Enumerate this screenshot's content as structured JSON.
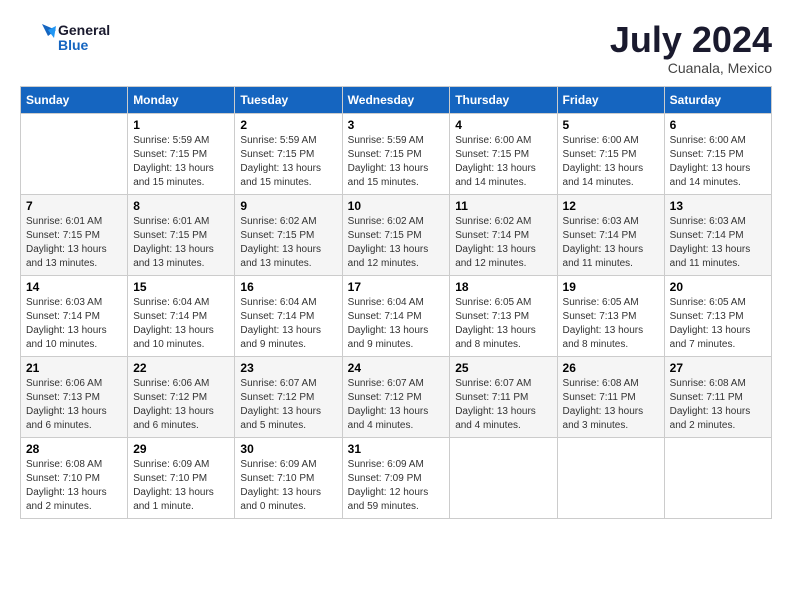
{
  "header": {
    "logo_line1": "General",
    "logo_line2": "Blue",
    "month_year": "July 2024",
    "location": "Cuanala, Mexico"
  },
  "days_of_week": [
    "Sunday",
    "Monday",
    "Tuesday",
    "Wednesday",
    "Thursday",
    "Friday",
    "Saturday"
  ],
  "weeks": [
    [
      {
        "num": "",
        "info": ""
      },
      {
        "num": "1",
        "info": "Sunrise: 5:59 AM\nSunset: 7:15 PM\nDaylight: 13 hours\nand 15 minutes."
      },
      {
        "num": "2",
        "info": "Sunrise: 5:59 AM\nSunset: 7:15 PM\nDaylight: 13 hours\nand 15 minutes."
      },
      {
        "num": "3",
        "info": "Sunrise: 5:59 AM\nSunset: 7:15 PM\nDaylight: 13 hours\nand 15 minutes."
      },
      {
        "num": "4",
        "info": "Sunrise: 6:00 AM\nSunset: 7:15 PM\nDaylight: 13 hours\nand 14 minutes."
      },
      {
        "num": "5",
        "info": "Sunrise: 6:00 AM\nSunset: 7:15 PM\nDaylight: 13 hours\nand 14 minutes."
      },
      {
        "num": "6",
        "info": "Sunrise: 6:00 AM\nSunset: 7:15 PM\nDaylight: 13 hours\nand 14 minutes."
      }
    ],
    [
      {
        "num": "7",
        "info": "Sunrise: 6:01 AM\nSunset: 7:15 PM\nDaylight: 13 hours\nand 13 minutes."
      },
      {
        "num": "8",
        "info": "Sunrise: 6:01 AM\nSunset: 7:15 PM\nDaylight: 13 hours\nand 13 minutes."
      },
      {
        "num": "9",
        "info": "Sunrise: 6:02 AM\nSunset: 7:15 PM\nDaylight: 13 hours\nand 13 minutes."
      },
      {
        "num": "10",
        "info": "Sunrise: 6:02 AM\nSunset: 7:15 PM\nDaylight: 13 hours\nand 12 minutes."
      },
      {
        "num": "11",
        "info": "Sunrise: 6:02 AM\nSunset: 7:14 PM\nDaylight: 13 hours\nand 12 minutes."
      },
      {
        "num": "12",
        "info": "Sunrise: 6:03 AM\nSunset: 7:14 PM\nDaylight: 13 hours\nand 11 minutes."
      },
      {
        "num": "13",
        "info": "Sunrise: 6:03 AM\nSunset: 7:14 PM\nDaylight: 13 hours\nand 11 minutes."
      }
    ],
    [
      {
        "num": "14",
        "info": "Sunrise: 6:03 AM\nSunset: 7:14 PM\nDaylight: 13 hours\nand 10 minutes."
      },
      {
        "num": "15",
        "info": "Sunrise: 6:04 AM\nSunset: 7:14 PM\nDaylight: 13 hours\nand 10 minutes."
      },
      {
        "num": "16",
        "info": "Sunrise: 6:04 AM\nSunset: 7:14 PM\nDaylight: 13 hours\nand 9 minutes."
      },
      {
        "num": "17",
        "info": "Sunrise: 6:04 AM\nSunset: 7:14 PM\nDaylight: 13 hours\nand 9 minutes."
      },
      {
        "num": "18",
        "info": "Sunrise: 6:05 AM\nSunset: 7:13 PM\nDaylight: 13 hours\nand 8 minutes."
      },
      {
        "num": "19",
        "info": "Sunrise: 6:05 AM\nSunset: 7:13 PM\nDaylight: 13 hours\nand 8 minutes."
      },
      {
        "num": "20",
        "info": "Sunrise: 6:05 AM\nSunset: 7:13 PM\nDaylight: 13 hours\nand 7 minutes."
      }
    ],
    [
      {
        "num": "21",
        "info": "Sunrise: 6:06 AM\nSunset: 7:13 PM\nDaylight: 13 hours\nand 6 minutes."
      },
      {
        "num": "22",
        "info": "Sunrise: 6:06 AM\nSunset: 7:12 PM\nDaylight: 13 hours\nand 6 minutes."
      },
      {
        "num": "23",
        "info": "Sunrise: 6:07 AM\nSunset: 7:12 PM\nDaylight: 13 hours\nand 5 minutes."
      },
      {
        "num": "24",
        "info": "Sunrise: 6:07 AM\nSunset: 7:12 PM\nDaylight: 13 hours\nand 4 minutes."
      },
      {
        "num": "25",
        "info": "Sunrise: 6:07 AM\nSunset: 7:11 PM\nDaylight: 13 hours\nand 4 minutes."
      },
      {
        "num": "26",
        "info": "Sunrise: 6:08 AM\nSunset: 7:11 PM\nDaylight: 13 hours\nand 3 minutes."
      },
      {
        "num": "27",
        "info": "Sunrise: 6:08 AM\nSunset: 7:11 PM\nDaylight: 13 hours\nand 2 minutes."
      }
    ],
    [
      {
        "num": "28",
        "info": "Sunrise: 6:08 AM\nSunset: 7:10 PM\nDaylight: 13 hours\nand 2 minutes."
      },
      {
        "num": "29",
        "info": "Sunrise: 6:09 AM\nSunset: 7:10 PM\nDaylight: 13 hours\nand 1 minute."
      },
      {
        "num": "30",
        "info": "Sunrise: 6:09 AM\nSunset: 7:10 PM\nDaylight: 13 hours\nand 0 minutes."
      },
      {
        "num": "31",
        "info": "Sunrise: 6:09 AM\nSunset: 7:09 PM\nDaylight: 12 hours\nand 59 minutes."
      },
      {
        "num": "",
        "info": ""
      },
      {
        "num": "",
        "info": ""
      },
      {
        "num": "",
        "info": ""
      }
    ]
  ]
}
